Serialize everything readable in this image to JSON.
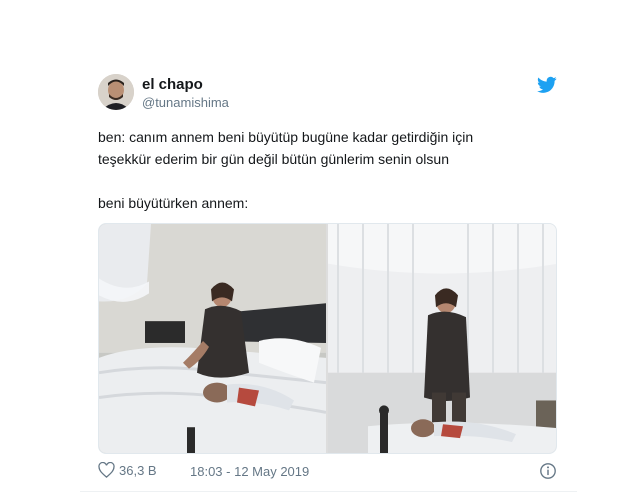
{
  "user": {
    "display_name": "el chapo",
    "handle": "@tunamishima"
  },
  "tweet": {
    "lines": [
      "ben: canım annem beni büyütüp bugüne kadar getirdiğin için",
      "teşekkür ederim bir gün değil bütün günlerim senin olsun",
      "",
      "beni büyütürken annem:"
    ]
  },
  "footer": {
    "likes": "36,3 B",
    "timestamp": "18:03 - 12 May 2019"
  },
  "icons": {
    "brand": "twitter-bird-icon",
    "like": "heart-icon",
    "info": "info-icon"
  },
  "colors": {
    "brand": "#1da1f2",
    "secondary_text": "#657786",
    "primary_text": "#14171a"
  }
}
